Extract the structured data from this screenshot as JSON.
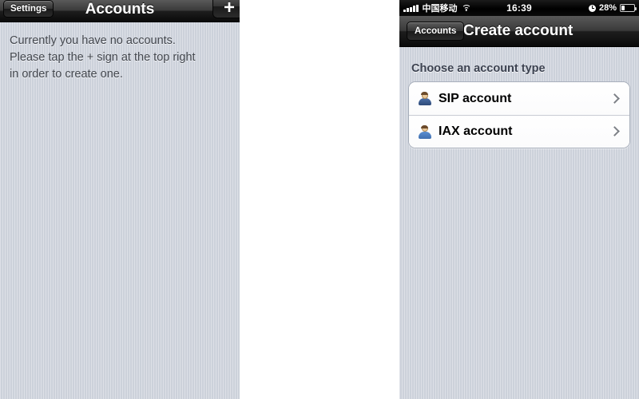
{
  "left_panel": {
    "navbar": {
      "back_button_label": "Settings",
      "title": "Accounts",
      "add_button_label": "+",
      "add_button_icon": "plus-icon"
    },
    "empty_state": {
      "line1": "Currently you have no accounts.",
      "line2": "Please tap the + sign at the top right",
      "line3": "in order to create one."
    }
  },
  "right_panel": {
    "status_bar": {
      "signal_icon": "signal-bars-icon",
      "carrier": "中国移动",
      "wifi_icon": "wifi-icon",
      "time": "16:39",
      "alarm_icon": "alarm-clock-icon",
      "battery_percent": "28%",
      "battery_icon": "battery-icon"
    },
    "navbar": {
      "back_button_label": "Accounts",
      "title": "Create account"
    },
    "section": {
      "header": "Choose an account type",
      "rows": [
        {
          "label": "SIP account",
          "icon": "person-icon",
          "accessory": "chevron-right-icon"
        },
        {
          "label": "IAX account",
          "icon": "person-icon",
          "accessory": "chevron-right-icon"
        }
      ]
    }
  },
  "colors": {
    "screen_background": "#ced3dd",
    "navbar_dark": "#1d1d1d",
    "row_background": "#ffffff",
    "header_text": "#3c4250",
    "body_text": "#43474e",
    "chevron": "#7d8187"
  }
}
